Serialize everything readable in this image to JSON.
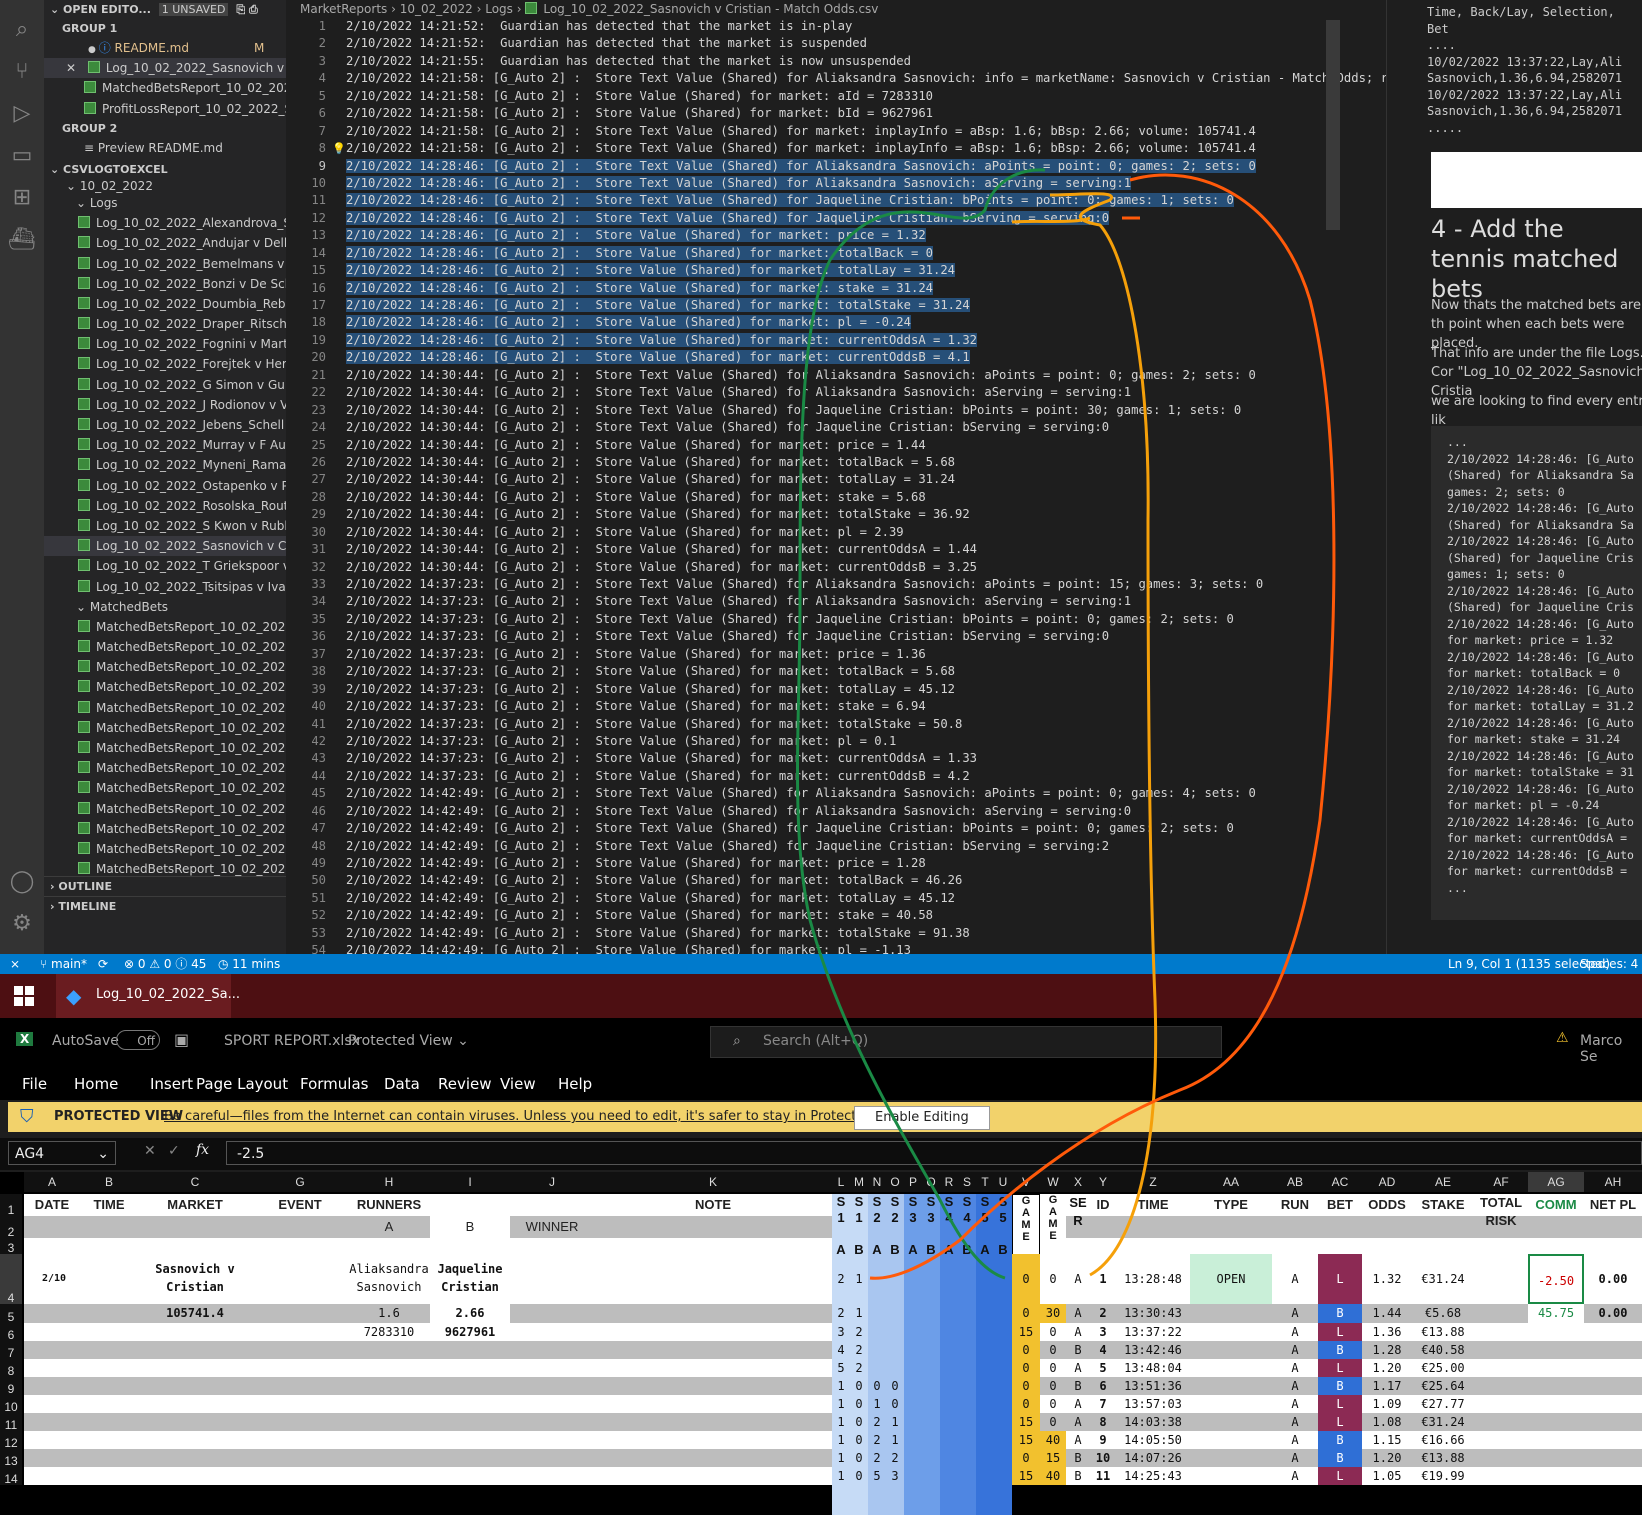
{
  "vscode": {
    "explorer": {
      "open_editors_label": "OPEN EDITO...",
      "unsaved_badge": "1 UNSAVED",
      "group1_label": "GROUP 1",
      "group1_items": [
        "README.md",
        "Log_10_02_2022_Sasnovich v Cri...",
        "MatchedBetsReport_10_02_2022...",
        "ProfitLossReport_10_02_2022_Sa..."
      ],
      "readme_mark": "M",
      "group2_label": "GROUP 2",
      "group2_items": [
        "Preview README.md"
      ],
      "workspace_label": "CSVLOGTOEXCEL",
      "folder_date": "10_02_2022",
      "folder_logs": "Logs",
      "logs": [
        "Log_10_02_2022_Alexandrova_Sizi...",
        "Log_10_02_2022_Andujar v Delbo...",
        "Log_10_02_2022_Bemelmans v Ha...",
        "Log_10_02_2022_Bonzi v De Sche...",
        "Log_10_02_2022_Doumbia_Rebou...",
        "Log_10_02_2022_Draper_Ritschar...",
        "Log_10_02_2022_Fognini v Martin...",
        "Log_10_02_2022_Forejtek v Herbe...",
        "Log_10_02_2022_G Simon v Gulbi...",
        "Log_10_02_2022_J Rodionov v V P...",
        "Log_10_02_2022_Jebens_Schell v ...",
        "Log_10_02_2022_Murray v F Auge...",
        "Log_10_02_2022_Myneni_Ramana...",
        "Log_10_02_2022_Ostapenko v Pet...",
        "Log_10_02_2022_Rosolska_Routlif...",
        "Log_10_02_2022_S Kwon v Rublev...",
        "Log_10_02_2022_Sasnovich v Cris...",
        "Log_10_02_2022_T Griekspoor v F...",
        "Log_10_02_2022_Tsitsipas v Ivash..."
      ],
      "folder_matched": "MatchedBets",
      "matched": [
        "MatchedBetsReport_10_02_2022_...",
        "MatchedBetsReport_10_02_2022_...",
        "MatchedBetsReport_10_02_2022_...",
        "MatchedBetsReport_10_02_2022_...",
        "MatchedBetsReport_10_02_2022_...",
        "MatchedBetsReport_10_02_2022_...",
        "MatchedBetsReport_10_02_2022_...",
        "MatchedBetsReport_10_02_2022_...",
        "MatchedBetsReport_10_02_2022_...",
        "MatchedBetsReport_10_02_2022_...",
        "MatchedBetsReport_10_02_2022_...",
        "MatchedBetsReport_10_02_2022_...",
        "MatchedBetsReport_10_02_2022_...",
        "MatchedBetsReport_10_02_2022_...",
        "MatchedBetsReport_10_02_2022_..."
      ],
      "outline_label": "OUTLINE",
      "timeline_label": "TIMELINE"
    },
    "breadcrumbs": [
      "MarketReports",
      "10_02_2022",
      "Logs",
      "Log_10_02_2022_Sasnovich v Cristian - Match Odds.csv"
    ],
    "code_lines": [
      "2/10/2022 14:21:52:  Guardian has detected that the market is in-play",
      "2/10/2022 14:21:52:  Guardian has detected that the market is suspended",
      "2/10/2022 14:21:55:  Guardian has detected that the market is now unsuspended",
      "2/10/2022 14:21:58: [G_Auto 2] :  Store Text Value (Shared) for Aliaksandra Sasnovich: info = marketName: Sasnovich v Cristian - Match Odds; runner",
      "2/10/2022 14:21:58: [G_Auto 2] :  Store Value (Shared) for market: aId = 7283310",
      "2/10/2022 14:21:58: [G_Auto 2] :  Store Value (Shared) for market: bId = 9627961",
      "2/10/2022 14:21:58: [G_Auto 2] :  Store Text Value (Shared) for market: inplayInfo = aBsp: 1.6; bBsp: 2.66; volume: 105741.4",
      "2/10/2022 14:21:58: [G_Auto 2] :  Store Text Value (Shared) for market: inplayInfo = aBsp: 1.6; bBsp: 2.66; volume: 105741.4",
      "2/10/2022 14:28:46: [G_Auto 2] :  Store Text Value (Shared) for Aliaksandra Sasnovich: aPoints = point: 0; games: 2; sets: 0",
      "2/10/2022 14:28:46: [G_Auto 2] :  Store Text Value (Shared) for Aliaksandra Sasnovich: aServing = serving:1",
      "2/10/2022 14:28:46: [G_Auto 2] :  Store Text Value (Shared) for Jaqueline Cristian: bPoints = point: 0; games: 1; sets: 0",
      "2/10/2022 14:28:46: [G_Auto 2] :  Store Text Value (Shared) for Jaqueline Cristian: bServing = serving:0",
      "2/10/2022 14:28:46: [G_Auto 2] :  Store Value (Shared) for market: price = 1.32",
      "2/10/2022 14:28:46: [G_Auto 2] :  Store Value (Shared) for market: totalBack = 0",
      "2/10/2022 14:28:46: [G_Auto 2] :  Store Value (Shared) for market: totalLay = 31.24",
      "2/10/2022 14:28:46: [G_Auto 2] :  Store Value (Shared) for market: stake = 31.24",
      "2/10/2022 14:28:46: [G_Auto 2] :  Store Value (Shared) for market: totalStake = 31.24",
      "2/10/2022 14:28:46: [G_Auto 2] :  Store Value (Shared) for market: pl = -0.24",
      "2/10/2022 14:28:46: [G_Auto 2] :  Store Value (Shared) for market: currentOddsA = 1.32",
      "2/10/2022 14:28:46: [G_Auto 2] :  Store Value (Shared) for market: currentOddsB = 4.1",
      "2/10/2022 14:30:44: [G_Auto 2] :  Store Text Value (Shared) for Aliaksandra Sasnovich: aPoints = point: 0; games: 2; sets: 0",
      "2/10/2022 14:30:44: [G_Auto 2] :  Store Text Value (Shared) for Aliaksandra Sasnovich: aServing = serving:1",
      "2/10/2022 14:30:44: [G_Auto 2] :  Store Text Value (Shared) for Jaqueline Cristian: bPoints = point: 30; games: 1; sets: 0",
      "2/10/2022 14:30:44: [G_Auto 2] :  Store Text Value (Shared) for Jaqueline Cristian: bServing = serving:0",
      "2/10/2022 14:30:44: [G_Auto 2] :  Store Value (Shared) for market: price = 1.44",
      "2/10/2022 14:30:44: [G_Auto 2] :  Store Value (Shared) for market: totalBack = 5.68",
      "2/10/2022 14:30:44: [G_Auto 2] :  Store Value (Shared) for market: totalLay = 31.24",
      "2/10/2022 14:30:44: [G_Auto 2] :  Store Value (Shared) for market: stake = 5.68",
      "2/10/2022 14:30:44: [G_Auto 2] :  Store Value (Shared) for market: totalStake = 36.92",
      "2/10/2022 14:30:44: [G_Auto 2] :  Store Value (Shared) for market: pl = 2.39",
      "2/10/2022 14:30:44: [G_Auto 2] :  Store Value (Shared) for market: currentOddsA = 1.44",
      "2/10/2022 14:30:44: [G_Auto 2] :  Store Value (Shared) for market: currentOddsB = 3.25",
      "2/10/2022 14:37:23: [G_Auto 2] :  Store Text Value (Shared) for Aliaksandra Sasnovich: aPoints = point: 15; games: 3; sets: 0",
      "2/10/2022 14:37:23: [G_Auto 2] :  Store Text Value (Shared) for Aliaksandra Sasnovich: aServing = serving:1",
      "2/10/2022 14:37:23: [G_Auto 2] :  Store Text Value (Shared) for Jaqueline Cristian: bPoints = point: 0; games: 2; sets: 0",
      "2/10/2022 14:37:23: [G_Auto 2] :  Store Text Value (Shared) for Jaqueline Cristian: bServing = serving:0",
      "2/10/2022 14:37:23: [G_Auto 2] :  Store Value (Shared) for market: price = 1.36",
      "2/10/2022 14:37:23: [G_Auto 2] :  Store Value (Shared) for market: totalBack = 5.68",
      "2/10/2022 14:37:23: [G_Auto 2] :  Store Value (Shared) for market: totalLay = 45.12",
      "2/10/2022 14:37:23: [G_Auto 2] :  Store Value (Shared) for market: stake = 6.94",
      "2/10/2022 14:37:23: [G_Auto 2] :  Store Value (Shared) for market: totalStake = 50.8",
      "2/10/2022 14:37:23: [G_Auto 2] :  Store Value (Shared) for market: pl = 0.1",
      "2/10/2022 14:37:23: [G_Auto 2] :  Store Value (Shared) for market: currentOddsA = 1.33",
      "2/10/2022 14:37:23: [G_Auto 2] :  Store Value (Shared) for market: currentOddsB = 4.2",
      "2/10/2022 14:42:49: [G_Auto 2] :  Store Text Value (Shared) for Aliaksandra Sasnovich: aPoints = point: 0; games: 4; sets: 0",
      "2/10/2022 14:42:49: [G_Auto 2] :  Store Text Value (Shared) for Aliaksandra Sasnovich: aServing = serving:0",
      "2/10/2022 14:42:49: [G_Auto 2] :  Store Text Value (Shared) for Jaqueline Cristian: bPoints = point: 0; games: 2; sets: 0",
      "2/10/2022 14:42:49: [G_Auto 2] :  Store Text Value (Shared) for Jaqueline Cristian: bServing = serving:2",
      "2/10/2022 14:42:49: [G_Auto 2] :  Store Value (Shared) for market: price = 1.28",
      "2/10/2022 14:42:49: [G_Auto 2] :  Store Value (Shared) for market: totalBack = 46.26",
      "2/10/2022 14:42:49: [G_Auto 2] :  Store Value (Shared) for market: totalLay = 45.12",
      "2/10/2022 14:42:49: [G_Auto 2] :  Store Value (Shared) for market: stake = 40.58",
      "2/10/2022 14:42:49: [G_Auto 2] :  Store Value (Shared) for market: totalStake = 91.38",
      "2/10/2022 14:42:49: [G_Auto 2] :  Store Value (Shared) for market: pl = -1.13"
    ],
    "right_pane": {
      "top_mono": [
        "Time, Back/Lay, Selection,",
        "Bet",
        "....",
        "10/02/2022 13:37:22,Lay,Ali",
        "Sasnovich,1.36,6.94,2582071",
        "10/02/2022 13:37:22,Lay,Ali",
        "Sasnovich,1.36,6.94,2582071",
        "....."
      ],
      "heading": "4 - Add the tennis matched bets",
      "para1": "Now thats the matched bets are in th point when each bets were placed.",
      "para2": "That info are under the file Logs. Cor \"Log_10_02_2022_Sasnovich v Cristia",
      "para3": "we are looking to find every entry lik",
      "code": [
        "...",
        "2/10/2022 14:28:46: [G_Auto",
        "(Shared) for Aliaksandra Sa",
        "games: 2; sets: 0",
        "2/10/2022 14:28:46: [G_Auto",
        "(Shared) for Aliaksandra Sa",
        "2/10/2022 14:28:46: [G_Auto",
        "(Shared) for Jaqueline Cris",
        "games: 1; sets: 0",
        "2/10/2022 14:28:46: [G_Auto",
        "(Shared) for Jaqueline Cris",
        "2/10/2022 14:28:46: [G_Auto",
        "for market: price = 1.32",
        "2/10/2022 14:28:46: [G_Auto",
        "for market: totalBack = 0",
        "2/10/2022 14:28:46: [G_Auto",
        "for market: totalLay = 31.2",
        "2/10/2022 14:28:46: [G_Auto",
        "for market: stake = 31.24",
        "2/10/2022 14:28:46: [G_Auto",
        "for market: totalStake = 31",
        "2/10/2022 14:28:46: [G_Auto",
        "for market: pl = -0.24",
        "2/10/2022 14:28:46: [G_Auto",
        "for market: currentOddsA =",
        "2/10/2022 14:28:46: [G_Auto",
        "for market: currentOddsB =",
        "..."
      ]
    },
    "statusbar": {
      "branch": "main*",
      "problems": "⊗ 0 ⚠ 0 ⓘ 45",
      "time": "11 mins",
      "position": "Ln 9, Col 1 (1135 selected)",
      "spaces": "Spaces: 4"
    }
  },
  "taskbar": {
    "app_tab": "Log_10_02_2022_Sa..."
  },
  "excel": {
    "autosave_label": "AutoSave",
    "autosave_state": "Off",
    "file_name": "SPORT REPORT.xlsx",
    "view_mode": "Protected View",
    "search_placeholder": "Search (Alt+Q)",
    "user": "Marco Se",
    "menu": [
      "File",
      "Home",
      "Insert",
      "Page Layout",
      "Formulas",
      "Data",
      "Review",
      "View",
      "Help"
    ],
    "protected": {
      "label": "PROTECTED VIEW",
      "message": "Be careful—files from the Internet can contain viruses. Unless you need to edit, it's safer to stay in Protected View.",
      "button": "Enable Editing"
    },
    "namebox": "AG4",
    "formula": "-2.5",
    "col_letters": [
      "A",
      "B",
      "C",
      "G",
      "H",
      "I",
      "J",
      "K",
      "L",
      "M",
      "N",
      "O",
      "P",
      "Q",
      "R",
      "S",
      "T",
      "U",
      "V",
      "W",
      "X",
      "Y",
      "Z",
      "AA",
      "AB",
      "AC",
      "AD",
      "AE",
      "AF",
      "AG",
      "AH"
    ],
    "headers": {
      "date": "DATE",
      "time": "TIME",
      "market": "MARKET",
      "event": "EVENT",
      "runners": "RUNNERS",
      "runner_a": "A",
      "runner_b": "B",
      "winner": "WINNER",
      "note": "NOTE",
      "sets": [
        "S\n1\n\nA",
        "S\n1\n\nB",
        "S\n2\n\nA",
        "S\n2\n\nB",
        "S\n3\n\nA",
        "S\n3\n\nB",
        "S\n4\n\nA",
        "S\n4\n\nB",
        "S\n5\n\nA",
        "S\n5\n\nB"
      ],
      "game_a": "G\nA\nM\nE\n\nA",
      "game_b": "G\nA\nM\nE\n\nB",
      "ser": "SE\nR",
      "id": "ID",
      "time2": "TIME",
      "type": "TYPE",
      "run": "RUN",
      "bet": "BET",
      "odds": "ODDS",
      "stake": "STAKE",
      "total_risk": "TOTAL\nRISK",
      "comm": "COMM",
      "net_pl": "NET PL"
    },
    "row4": {
      "date": "2/10",
      "market": "Sasnovich v\nCristian",
      "runner_a": "Aliaksandra\nSasnovich",
      "runner_b": "Jaqueline\nCristian"
    },
    "row5": {
      "volume": "105741.4",
      "bsp_a": "1.6",
      "bsp_b": "2.66",
      "comm2": "45.75",
      "netpl2": "0.00"
    },
    "row6": {
      "id_a": "7283310",
      "id_b": "9627961"
    },
    "bets": [
      {
        "s1a": "2",
        "s1b": "1",
        "s2a": "",
        "s2b": "",
        "ga": "0",
        "gb": "0",
        "ser": "A",
        "id": "1",
        "time": "13:28:48",
        "type": "OPEN",
        "run": "A",
        "bet": "L",
        "odds": "1.32",
        "stake": "€31.24",
        "comm": "-2.50",
        "net": "0.00"
      },
      {
        "s1a": "2",
        "s1b": "1",
        "s2a": "",
        "s2b": "",
        "ga": "0",
        "gb": "30",
        "ser": "A",
        "id": "2",
        "time": "13:30:43",
        "type": "",
        "run": "A",
        "bet": "B",
        "odds": "1.44",
        "stake": "€5.68",
        "comm": "",
        "net": ""
      },
      {
        "s1a": "3",
        "s1b": "2",
        "s2a": "",
        "s2b": "",
        "ga": "15",
        "gb": "0",
        "ser": "A",
        "id": "3",
        "time": "13:37:22",
        "type": "",
        "run": "A",
        "bet": "L",
        "odds": "1.36",
        "stake": "€13.88",
        "comm": "",
        "net": ""
      },
      {
        "s1a": "4",
        "s1b": "2",
        "s2a": "",
        "s2b": "",
        "ga": "0",
        "gb": "0",
        "ser": "B",
        "id": "4",
        "time": "13:42:46",
        "type": "",
        "run": "A",
        "bet": "B",
        "odds": "1.28",
        "stake": "€40.58",
        "comm": "",
        "net": ""
      },
      {
        "s1a": "5",
        "s1b": "2",
        "s2a": "",
        "s2b": "",
        "ga": "0",
        "gb": "0",
        "ser": "A",
        "id": "5",
        "time": "13:48:04",
        "type": "",
        "run": "A",
        "bet": "L",
        "odds": "1.20",
        "stake": "€25.00",
        "comm": "",
        "net": ""
      },
      {
        "s1a": "1",
        "s1b": "0",
        "s2a": "0",
        "s2b": "0",
        "ga": "0",
        "gb": "0",
        "ser": "B",
        "id": "6",
        "time": "13:51:36",
        "type": "",
        "run": "A",
        "bet": "B",
        "odds": "1.17",
        "stake": "€25.64",
        "comm": "",
        "net": ""
      },
      {
        "s1a": "1",
        "s1b": "0",
        "s2a": "1",
        "s2b": "0",
        "ga": "0",
        "gb": "0",
        "ser": "A",
        "id": "7",
        "time": "13:57:03",
        "type": "",
        "run": "A",
        "bet": "L",
        "odds": "1.09",
        "stake": "€27.77",
        "comm": "",
        "net": ""
      },
      {
        "s1a": "1",
        "s1b": "0",
        "s2a": "2",
        "s2b": "1",
        "ga": "15",
        "gb": "0",
        "ser": "A",
        "id": "8",
        "time": "14:03:38",
        "type": "",
        "run": "A",
        "bet": "L",
        "odds": "1.08",
        "stake": "€31.24",
        "comm": "",
        "net": ""
      },
      {
        "s1a": "1",
        "s1b": "0",
        "s2a": "2",
        "s2b": "1",
        "ga": "15",
        "gb": "40",
        "ser": "A",
        "id": "9",
        "time": "14:05:50",
        "type": "",
        "run": "A",
        "bet": "B",
        "odds": "1.15",
        "stake": "€16.66",
        "comm": "",
        "net": ""
      },
      {
        "s1a": "1",
        "s1b": "0",
        "s2a": "2",
        "s2b": "2",
        "ga": "0",
        "gb": "15",
        "ser": "B",
        "id": "10",
        "time": "14:07:26",
        "type": "",
        "run": "A",
        "bet": "B",
        "odds": "1.20",
        "stake": "€13.88",
        "comm": "",
        "net": ""
      },
      {
        "s1a": "1",
        "s1b": "0",
        "s2a": "5",
        "s2b": "3",
        "ga": "15",
        "gb": "40",
        "ser": "B",
        "id": "11",
        "time": "14:25:43",
        "type": "",
        "run": "A",
        "bet": "L",
        "odds": "1.05",
        "stake": "€19.99",
        "comm": "",
        "net": ""
      }
    ]
  },
  "colors": {
    "selection": "#264f78",
    "status": "#007acc",
    "lay": "#8c2a54",
    "back": "#2f6fd6",
    "open": "#c9efd8",
    "gold": "#f2c12e",
    "annot_green": "#1a8a45",
    "annot_orange": "#f5a00a",
    "annot_red": "#ff5a0a"
  }
}
